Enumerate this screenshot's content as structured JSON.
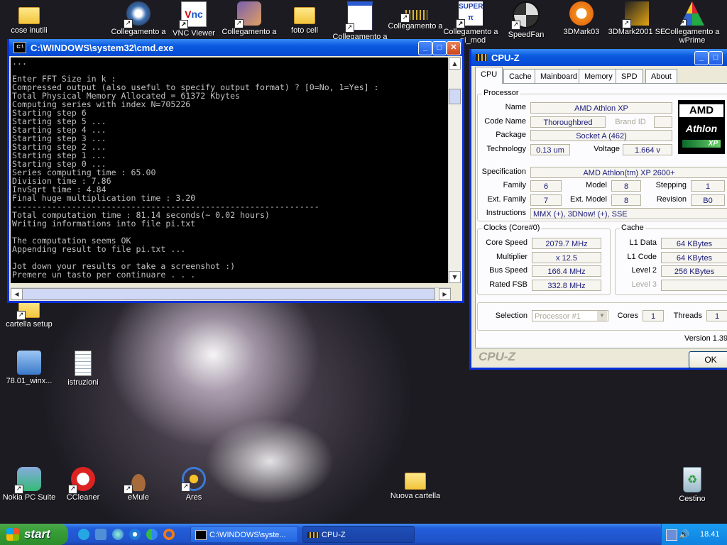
{
  "desktop_icons": [
    {
      "label": "cose inutili",
      "icon": "folder-icon"
    },
    {
      "label": "Collegamento a",
      "icon": "gauge-icon"
    },
    {
      "label": "VNC Viewer",
      "icon": "vnc-icon"
    },
    {
      "label": "Collegamento a",
      "icon": "app-icon"
    },
    {
      "label": "foto cell",
      "icon": "folder-icon"
    },
    {
      "label": "Collegamento a",
      "icon": "window-icon"
    },
    {
      "label": "Collegamento a",
      "icon": "chip-icon"
    },
    {
      "label": "Collegamento a _pi_mod",
      "icon": "superpi-icon"
    },
    {
      "label": "SpeedFan",
      "icon": "fan-icon"
    },
    {
      "label": "3DMark03",
      "icon": "3dmark-icon"
    },
    {
      "label": "3DMark2001 SE",
      "icon": "3dmark-icon"
    },
    {
      "label": "Collegamento a wPrime",
      "icon": "wprime-icon"
    },
    {
      "label": "cartella setup",
      "icon": "folder-icon"
    },
    {
      "label": "78.01_winx...",
      "icon": "installer-icon"
    },
    {
      "label": "istruzioni",
      "icon": "notepad-icon"
    },
    {
      "label": "Nokia PC Suite",
      "icon": "nokia-icon"
    },
    {
      "label": "CCleaner",
      "icon": "ccleaner-icon"
    },
    {
      "label": "eMule",
      "icon": "emule-icon"
    },
    {
      "label": "Ares",
      "icon": "ares-icon"
    },
    {
      "label": "Nuova cartella",
      "icon": "folder-icon"
    },
    {
      "label": "Cestino",
      "icon": "recycle-bin-icon"
    }
  ],
  "cmd": {
    "title": "C:\\WINDOWS\\system32\\cmd.exe",
    "lines": [
      "...",
      "",
      "Enter FFT Size in k :",
      "Compressed output (also useful to specify output format) ? [0=No, 1=Yes] :",
      "Total Physical Memory Allocated = 61372 Kbytes",
      "Computing series with index N=705226",
      "Starting step 6",
      "Starting step 5 ...",
      "Starting step 4 ...",
      "Starting step 3 ...",
      "Starting step 2 ...",
      "Starting step 1 ...",
      "Starting step 0 ...",
      "Series computing time : 65.00",
      "Division time : 7.86",
      "InvSqrt time : 4.84",
      "Final huge multiplication time : 3.20",
      "--------------------------------------------------------------",
      "Total computation time : 81.14 seconds(~ 0.02 hours)",
      "Writing informations into file pi.txt",
      "",
      "The computation seems OK",
      "Appending result to file pi.txt ...",
      "",
      "Jot down your results or take a screenshot :)",
      "Premere un tasto per continuare . . ."
    ]
  },
  "cpuz": {
    "title": "CPU-Z",
    "tabs": [
      "CPU",
      "Cache",
      "Mainboard",
      "Memory",
      "SPD",
      "About"
    ],
    "processor": {
      "group": "Processor",
      "name_label": "Name",
      "name": "AMD Athlon XP",
      "codename_label": "Code Name",
      "codename": "Thoroughbred",
      "brandid_label": "Brand ID",
      "package_label": "Package",
      "package": "Socket A (462)",
      "technology_label": "Technology",
      "technology": "0.13 um",
      "voltage_label": "Voltage",
      "voltage": "1.664 v",
      "logo_brand": "AMD",
      "logo_model": "Athlon",
      "logo_suffix": "XP",
      "spec_label": "Specification",
      "spec": "AMD Athlon(tm) XP  2600+",
      "family_label": "Family",
      "family": "6",
      "model_label": "Model",
      "model": "8",
      "stepping_label": "Stepping",
      "stepping": "1",
      "extfamily_label": "Ext. Family",
      "extfamily": "7",
      "extmodel_label": "Ext. Model",
      "extmodel": "8",
      "revision_label": "Revision",
      "revision": "B0",
      "instructions_label": "Instructions",
      "instructions": "MMX (+), 3DNow! (+), SSE"
    },
    "clocks": {
      "group": "Clocks (Core#0)",
      "corespeed_label": "Core Speed",
      "corespeed": "2079.7 MHz",
      "multiplier_label": "Multiplier",
      "multiplier": "x 12.5",
      "busspeed_label": "Bus Speed",
      "busspeed": "166.4 MHz",
      "ratedfsb_label": "Rated FSB",
      "ratedfsb": "332.8 MHz"
    },
    "cache": {
      "group": "Cache",
      "l1data_label": "L1 Data",
      "l1data": "64 KBytes",
      "l1code_label": "L1 Code",
      "l1code": "64 KBytes",
      "level2_label": "Level 2",
      "level2": "256 KBytes",
      "level3_label": "Level 3"
    },
    "selection_label": "Selection",
    "selection": "Processor #1",
    "cores_label": "Cores",
    "cores": "1",
    "threads_label": "Threads",
    "threads": "1",
    "version": "Version 1.39",
    "brand_footer": "CPU-Z",
    "ok_label": "OK"
  },
  "taskbar": {
    "start_label": "start",
    "tasks": [
      {
        "label": "C:\\WINDOWS\\syste...",
        "icon": "cmd-icon"
      },
      {
        "label": "CPU-Z",
        "icon": "chip-icon"
      }
    ],
    "clock": "18.41"
  }
}
